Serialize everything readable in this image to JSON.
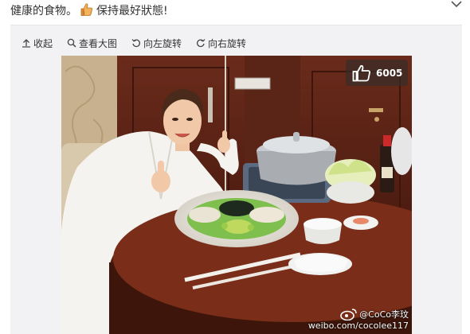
{
  "post": {
    "text_part1": "健康的食物。",
    "text_part2": "保持最好狀態!",
    "emoji_icon": "thumbs-up-emoji"
  },
  "toolbar": {
    "collapse_label": "收起",
    "view_large_label": "查看大图",
    "rotate_left_label": "向左旋转",
    "rotate_right_label": "向右旋转"
  },
  "photo": {
    "like_count": "6005",
    "watermark_handle": "@CoCo李玟",
    "watermark_url": "weibo.com/cocolee117"
  },
  "colors": {
    "panel_bg": "#f2f2f5",
    "badge_bg": "rgba(55,45,40,0.72)",
    "text": "#333333"
  }
}
